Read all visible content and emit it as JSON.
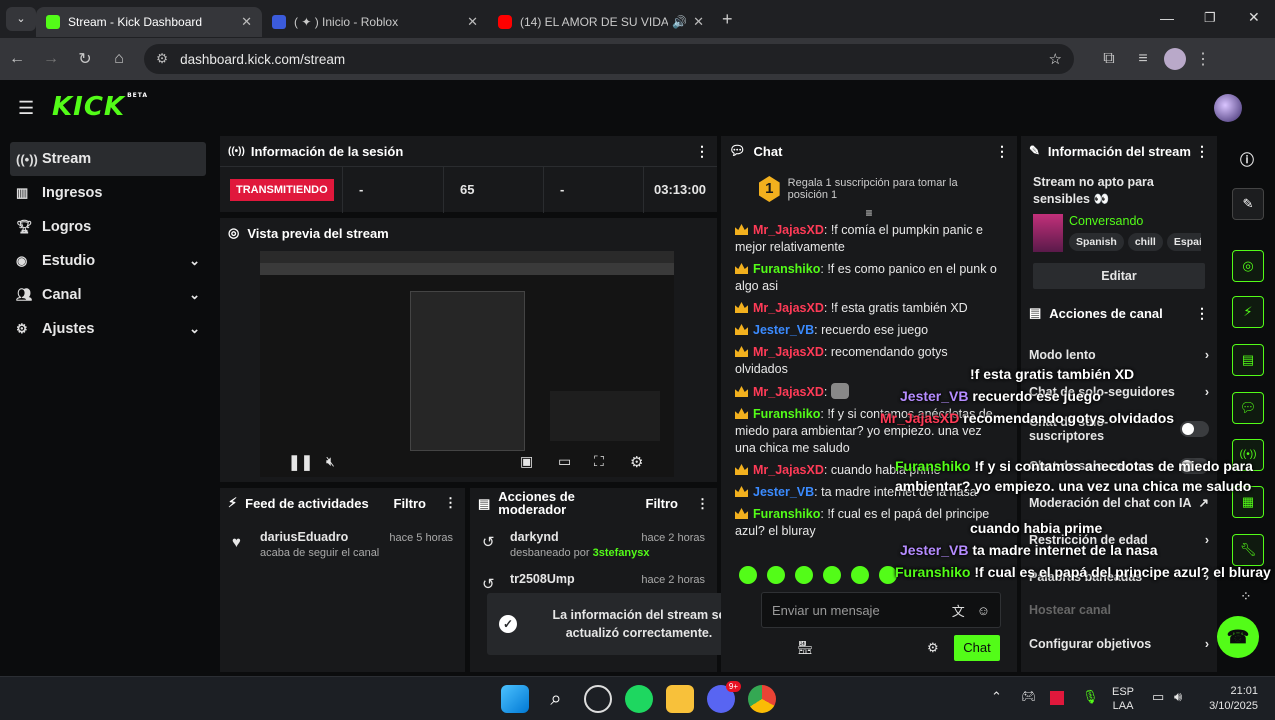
{
  "browser": {
    "tabs": [
      {
        "title": "Stream - Kick Dashboard",
        "color": "#53fc18"
      },
      {
        "title": "( ✦ ) Inicio - Roblox",
        "color": "#3b5bdb"
      },
      {
        "title": "(14) EL AMOR DE SU VIDA |",
        "color": "#ff0000"
      }
    ],
    "url": "dashboard.kick.com/stream"
  },
  "brand": {
    "logo": "KICK",
    "beta": "BETA",
    "accent": "#53fc18"
  },
  "sidebar": {
    "items": [
      {
        "label": "Stream",
        "icon": "broadcast-icon"
      },
      {
        "label": "Ingresos",
        "icon": "chart-icon"
      },
      {
        "label": "Logros",
        "icon": "trophy-icon"
      },
      {
        "label": "Estudio",
        "icon": "studio-icon"
      },
      {
        "label": "Canal",
        "icon": "people-icon"
      },
      {
        "label": "Ajustes",
        "icon": "gear-icon"
      }
    ]
  },
  "session": {
    "title": "Información de la sesión",
    "status": "TRANSMITIENDO",
    "col1": "-",
    "viewers": "65",
    "col3": "-",
    "time": "03:13:00"
  },
  "preview": {
    "title": "Vista previa del stream"
  },
  "feed": {
    "title": "Feed de actividades",
    "filter": "Filtro",
    "items": [
      {
        "user": "dariusEduadro",
        "desc": "acaba de seguir el canal",
        "time": "hace 5 horas"
      }
    ]
  },
  "modactions": {
    "title": "Acciones de moderador",
    "filter": "Filtro",
    "items": [
      {
        "user": "darkynd",
        "desc": "desbaneado por",
        "by": "3stefanysx",
        "time": "hace 2 horas"
      },
      {
        "user": "tr2508Ump",
        "time": "hace 2 horas"
      }
    ]
  },
  "toast": {
    "text": "La información del stream se actualizó correctamente."
  },
  "chat": {
    "title": "Chat",
    "gift_banner": "Regala 1 suscripción para tomar la posición 1",
    "gift_rank": "1",
    "messages": [
      {
        "user": "Mr_JajasXD",
        "color": "red",
        "text": "!f comía el pumpkin panic e mejor relativamente"
      },
      {
        "user": "Furanshiko",
        "color": "green",
        "text": "!f es como panico en el punk o algo asi"
      },
      {
        "user": "Mr_JajasXD",
        "color": "red",
        "text": "!f esta gratis también XD"
      },
      {
        "user": "Jester_VB",
        "color": "blue",
        "text": "recuerdo ese juego"
      },
      {
        "user": "Mr_JajasXD",
        "color": "red",
        "text": "recomendando gotys olvidados"
      },
      {
        "user": "Mr_JajasXD",
        "color": "red",
        "text": ""
      },
      {
        "user": "Furanshiko",
        "color": "green",
        "text": "!f y si contamos anécdotas de miedo para ambientar? yo empiezo. una vez una chica me saludo"
      },
      {
        "user": "Mr_JajasXD",
        "color": "red",
        "text": "cuando habia prime"
      },
      {
        "user": "Jester_VB",
        "color": "blue",
        "text": "ta madre internet de la nasa"
      },
      {
        "user": "Furanshiko",
        "color": "green",
        "text": "!f cual es el papá del principe azul? el bluray"
      }
    ],
    "placeholder": "Enviar un mensaje",
    "send": "Chat"
  },
  "streaminfo": {
    "title": "Información del stream",
    "name": "Stream no apto para sensibles 👀",
    "category": "Conversando",
    "tags": [
      "Spanish",
      "chill",
      "Españ"
    ],
    "edit": "Editar"
  },
  "channel": {
    "title": "Acciones de canal",
    "items": [
      {
        "label": "Modo lento",
        "type": "chevron"
      },
      {
        "label": "Chat de solo-seguidores",
        "type": "chevron"
      },
      {
        "label": "Chat de solo-suscriptores",
        "type": "toggle"
      },
      {
        "label": "Chat de solo-emotes",
        "type": "toggle"
      },
      {
        "label": "Moderación del chat con IA",
        "type": "external"
      },
      {
        "label": "Restricción de edad",
        "type": "chevron"
      },
      {
        "label": "Palabras baneadas",
        "type": "chevron"
      },
      {
        "label": "Hostear canal",
        "type": "disabled"
      },
      {
        "label": "Configurar objetivos",
        "type": "chevron"
      }
    ]
  },
  "overlay": {
    "lines": [
      {
        "user": "Mr_JajasXD",
        "text": "!f esta gratis también XD"
      },
      {
        "user": "Jester_VB",
        "text": "recuerdo ese juego"
      },
      {
        "user": "Mr_JajasXD",
        "text": "recomendando gotys olvidados"
      },
      {
        "user": "Furanshiko",
        "text": "!f y si contamos anecdotas de miedo para ambientar? yo empiezo. una vez una chica me saludo"
      },
      {
        "user": "",
        "text": "cuando habia prime"
      },
      {
        "user": "Jester_VB",
        "text": "ta madre internet de la nasa"
      },
      {
        "user": "Furanshiko",
        "text": "!f cual es el papá del principe azul? el bluray"
      }
    ]
  },
  "taskbar": {
    "lang": "ESP",
    "layout": "LAA",
    "time": "21:01",
    "date": "3/10/2025",
    "badge": "9+"
  }
}
